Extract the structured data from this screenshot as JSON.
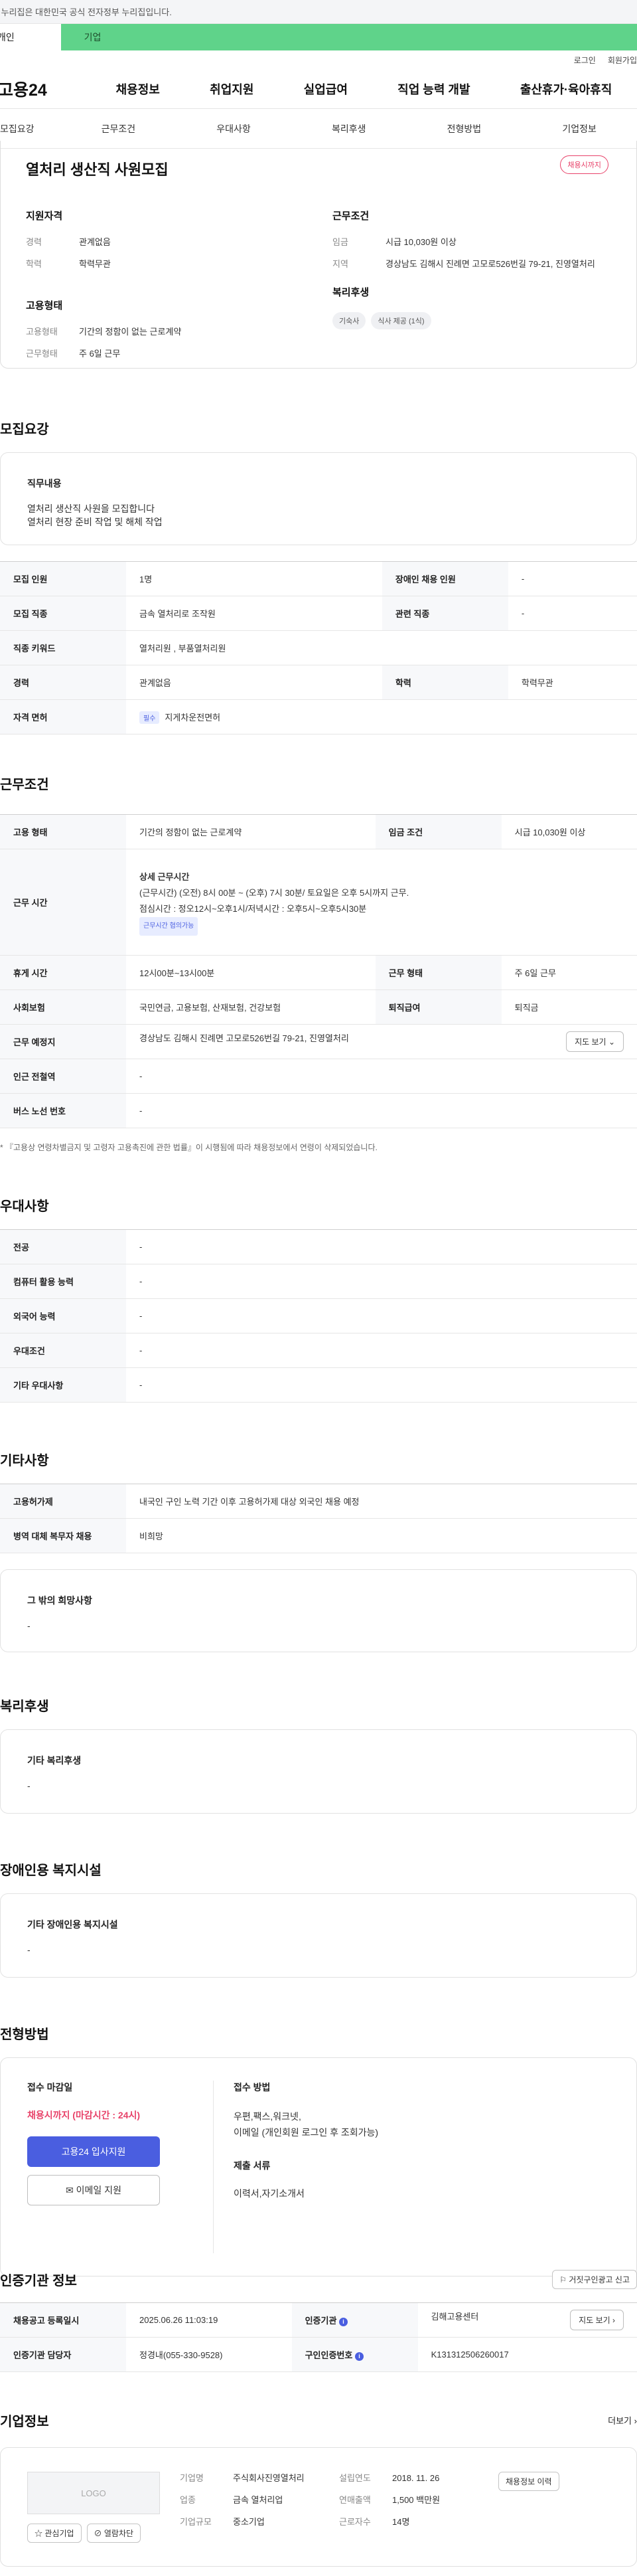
{
  "topbar": {
    "text": "이 누리집은 대한민국 공식 전자정부 누리집입니다."
  },
  "userbar": {
    "individual": "개인",
    "enterprise": "기업"
  },
  "util": {
    "login": "로그인",
    "join": "회원가입"
  },
  "gnb": {
    "logo": "고용24",
    "menu": [
      "채용정보",
      "취업지원",
      "실업급여",
      "직업 능력 개발",
      "출산휴가·육아휴직"
    ]
  },
  "subnav": [
    "모집요강",
    "근무조건",
    "우대사항",
    "복리후생",
    "전형방법",
    "기업정보"
  ],
  "job": {
    "title": "열처리 생산직 사원모집",
    "status": "채용시까지",
    "qual": {
      "heading": "지원자격",
      "career_k": "경력",
      "career_v": "관계없음",
      "edu_k": "학력",
      "edu_v": "학력무관"
    },
    "emp": {
      "heading": "고용형태",
      "type_k": "고용형태",
      "type_v": "기간의 정함이 없는 근로계약",
      "shape_k": "근무형태",
      "shape_v": "주 6일 근무"
    },
    "cond": {
      "heading": "근무조건",
      "wage_k": "임금",
      "wage_v": "시급 10,030원 이상",
      "loc_k": "지역",
      "loc_v": "경상남도 김해시 진례면 고모로526번길 79-21, 진영열처리"
    },
    "welfare": {
      "heading": "복리후생",
      "tags": [
        "기숙사",
        "식사 제공 (1식)"
      ]
    }
  },
  "recruit": {
    "heading": "모집요강",
    "duty_h": "직무내용",
    "duty_lines": [
      "열처리 생산직 사원을 모집합니다",
      "열처리 현장 준비 작업  및 해체 작업"
    ],
    "rows": {
      "count_k": "모집 인원",
      "count_v": "1명",
      "disab_k": "장애인 채용 인원",
      "disab_v": "-",
      "job_k": "모집 직종",
      "job_v": "금속 열처리로 조작원",
      "rel_k": "관련 직종",
      "rel_v": "-",
      "kw_k": "직종 키워드",
      "kw_v": "열처리원 , 부품열처리원",
      "career_k": "경력",
      "career_v": "관계없음",
      "edu_k": "학력",
      "edu_v": "학력무관",
      "lic_k": "자격 면허",
      "lic_badge": "필수",
      "lic_v": "지게차운전면허"
    }
  },
  "work": {
    "heading": "근무조건",
    "type_k": "고용 형태",
    "type_v": "기간의 정함이 없는 근로계약",
    "wage_k": "임금 조건",
    "wage_v": "시급 10,030원 이상",
    "time_k": "근무 시간",
    "time_h": "상세 근무시간",
    "time_l1": "(근무시간) (오전) 8시 00분 ~ (오후) 7시 30분/ 토요일은 오후 5시까지 근무.",
    "time_l2": "점심시간 : 정오12시~오후1시/저녁시간 : 오후5시~오후5시30분",
    "time_badge": "근무시간 협의가능",
    "break_k": "휴게 시간",
    "break_v": "12시00분~13시00분",
    "shape_k": "근무 형태",
    "shape_v": "주 6일 근무",
    "ins_k": "사회보험",
    "ins_v": "국민연금, 고용보험, 산재보험, 건강보험",
    "sev_k": "퇴직급여",
    "sev_v": "퇴직금",
    "place_k": "근무 예정지",
    "place_v": "경상남도 김해시 진례면 고모로526번길 79-21, 진영열처리",
    "map_btn": "지도 보기",
    "subway_k": "인근 전철역",
    "subway_v": "-",
    "bus_k": "버스 노선 번호",
    "bus_v": "-",
    "note": "* 『고용상 연령차별금지 및 고령자 고용촉진에 관한 법률』이 시행됨에 따라 채용정보에서 연령이 삭제되었습니다."
  },
  "pref": {
    "heading": "우대사항",
    "rows": [
      {
        "k": "전공",
        "v": "-"
      },
      {
        "k": "컴퓨터 활용 능력",
        "v": "-"
      },
      {
        "k": "외국어 능력",
        "v": "-"
      },
      {
        "k": "우대조건",
        "v": "-"
      },
      {
        "k": "기타 우대사항",
        "v": "-"
      }
    ]
  },
  "etc": {
    "heading": "기타사항",
    "foreign_k": "고용허가제",
    "foreign_v": "내국인 구인 노력 기간 이후 고용허가제 대상 외국인 채용 예정",
    "military_k": "병역 대체 복무자 채용",
    "military_v": "비희망",
    "hope_h": "그 밖의 희망사항",
    "hope_v": "-"
  },
  "welfare": {
    "heading": "복리후생",
    "box_h": "기타 복리후생",
    "box_v": "-"
  },
  "disab": {
    "heading": "장애인용 복지시설",
    "box_h": "기타 장애인용 복지시설",
    "box_v": "-"
  },
  "apply": {
    "heading": "전형방법",
    "deadline_h": "접수 마감일",
    "deadline_v": "채용시까지 (마감시간 : 24시)",
    "apply_btn": "고용24 입사지원",
    "email_btn": "이메일 지원",
    "method_h": "접수 방법",
    "method_v1": "우편,팩스,워크넷,",
    "method_v2": "이메일 (개인회원 로그인 후 조회가능)",
    "docs_h": "제출 서류",
    "docs_v": "이력서,자기소개서"
  },
  "cert": {
    "heading": "인증기관 정보",
    "report_btn": "거짓구인광고 신고",
    "reg_k": "채용공고 등록일시",
    "reg_v": "2025.06.26 11:03:19",
    "org_k": "인증기관",
    "org_v": "김해고용센터",
    "map_btn": "지도 보기",
    "mgr_k": "인증기관 담당자",
    "mgr_v": "정경내(055-330-9528)",
    "no_k": "구인인증번호",
    "no_v": "K131312506260017"
  },
  "company": {
    "heading": "기업정보",
    "more": "더보기",
    "logo": "LOGO",
    "fav_btn": "관심기업",
    "block_btn": "열람차단",
    "name_k": "기업명",
    "name_v": "주식회사진영열처리",
    "ind_k": "업종",
    "ind_v": "금속 열처리업",
    "size_k": "기업규모",
    "size_v": "중소기업",
    "est_k": "설립연도",
    "est_v": "2018. 11. 26",
    "sales_k": "연매출액",
    "sales_v": "1,500 백만원",
    "emp_k": "근로자수",
    "emp_v": "14명",
    "history_btn": "채용정보 이력"
  },
  "colors": {
    "primary": "#4a5ee0",
    "status": "#e8436a",
    "enterprise_bar": "#5fd38a"
  }
}
